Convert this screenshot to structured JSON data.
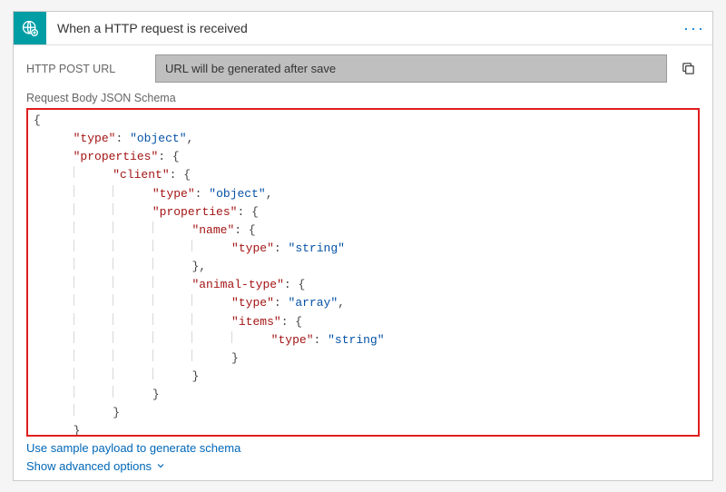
{
  "header": {
    "title": "When a HTTP request is received",
    "icon": "globe-gear-icon",
    "menu_label": "···"
  },
  "url": {
    "label": "HTTP POST URL",
    "value": "URL will be generated after save"
  },
  "schema": {
    "label": "Request Body JSON Schema",
    "json": {
      "type": "object",
      "properties": {
        "client": {
          "type": "object",
          "properties": {
            "name": {
              "type": "string"
            },
            "animal-type": {
              "type": "array",
              "items": {
                "type": "string"
              }
            }
          }
        }
      }
    },
    "tokens": {
      "type": "type",
      "object": "object",
      "properties": "properties",
      "client": "client",
      "name": "name",
      "string": "string",
      "animal_type": "animal-type",
      "array": "array",
      "items": "items"
    }
  },
  "links": {
    "sample_payload": "Use sample payload to generate schema",
    "advanced": "Show advanced options"
  }
}
